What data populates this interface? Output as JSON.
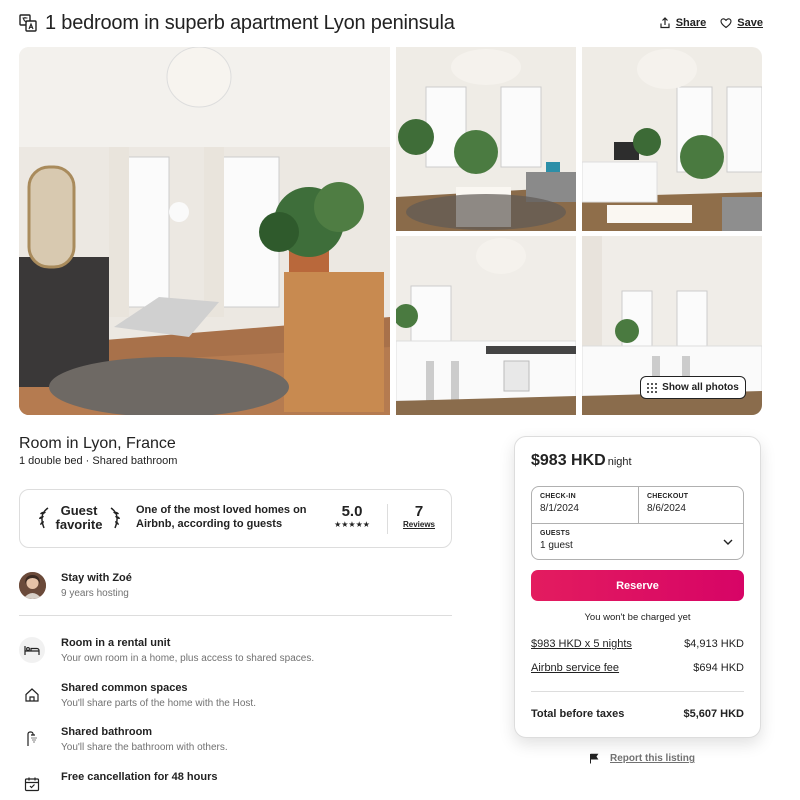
{
  "header": {
    "title": "1 bedroom in superb apartment Lyon peninsula",
    "share_label": "Share",
    "save_label": "Save",
    "translate_icon": "translate-icon"
  },
  "gallery": {
    "show_all_label": "Show all photos"
  },
  "listing": {
    "room_title": "Room in Lyon, France",
    "room_sub": "1 double bed · Shared bathroom"
  },
  "guest_favorite": {
    "label_line1": "Guest",
    "label_line2": "favorite",
    "description": "One of the most loved homes on Airbnb, according to guests",
    "rating": "5.0",
    "stars": "★★★★★",
    "reviews_count": "7",
    "reviews_label": "Reviews"
  },
  "host": {
    "name": "Stay with Zoé",
    "years": "9 years hosting"
  },
  "features": [
    {
      "title": "Room in a rental unit",
      "desc": "Your own room in a home, plus access to shared spaces.",
      "icon": "bed-icon"
    },
    {
      "title": "Shared common spaces",
      "desc": "You'll share parts of the home with the Host.",
      "icon": "home-icon"
    },
    {
      "title": "Shared bathroom",
      "desc": "You'll share the bathroom with others.",
      "icon": "shower-icon"
    },
    {
      "title": "Free cancellation for 48 hours",
      "desc": "",
      "icon": "calendar-icon"
    }
  ],
  "booking": {
    "price": "$983 HKD",
    "price_unit": "night",
    "checkin_label": "CHECK-IN",
    "checkin_value": "8/1/2024",
    "checkout_label": "CHECKOUT",
    "checkout_value": "8/6/2024",
    "guests_label": "GUESTS",
    "guests_value": "1 guest",
    "reserve_label": "Reserve",
    "no_charge": "You won't be charged yet",
    "nights_label": "$983 HKD x 5 nights",
    "nights_value": "$4,913 HKD",
    "fee_label": "Airbnb service fee",
    "fee_value": "$694 HKD",
    "total_label": "Total before taxes",
    "total_value": "$5,607 HKD"
  },
  "report_label": "Report this listing",
  "colors": {
    "brand": "#e31c5f",
    "text": "#222222",
    "muted": "#717171",
    "border": "#dddddd"
  }
}
